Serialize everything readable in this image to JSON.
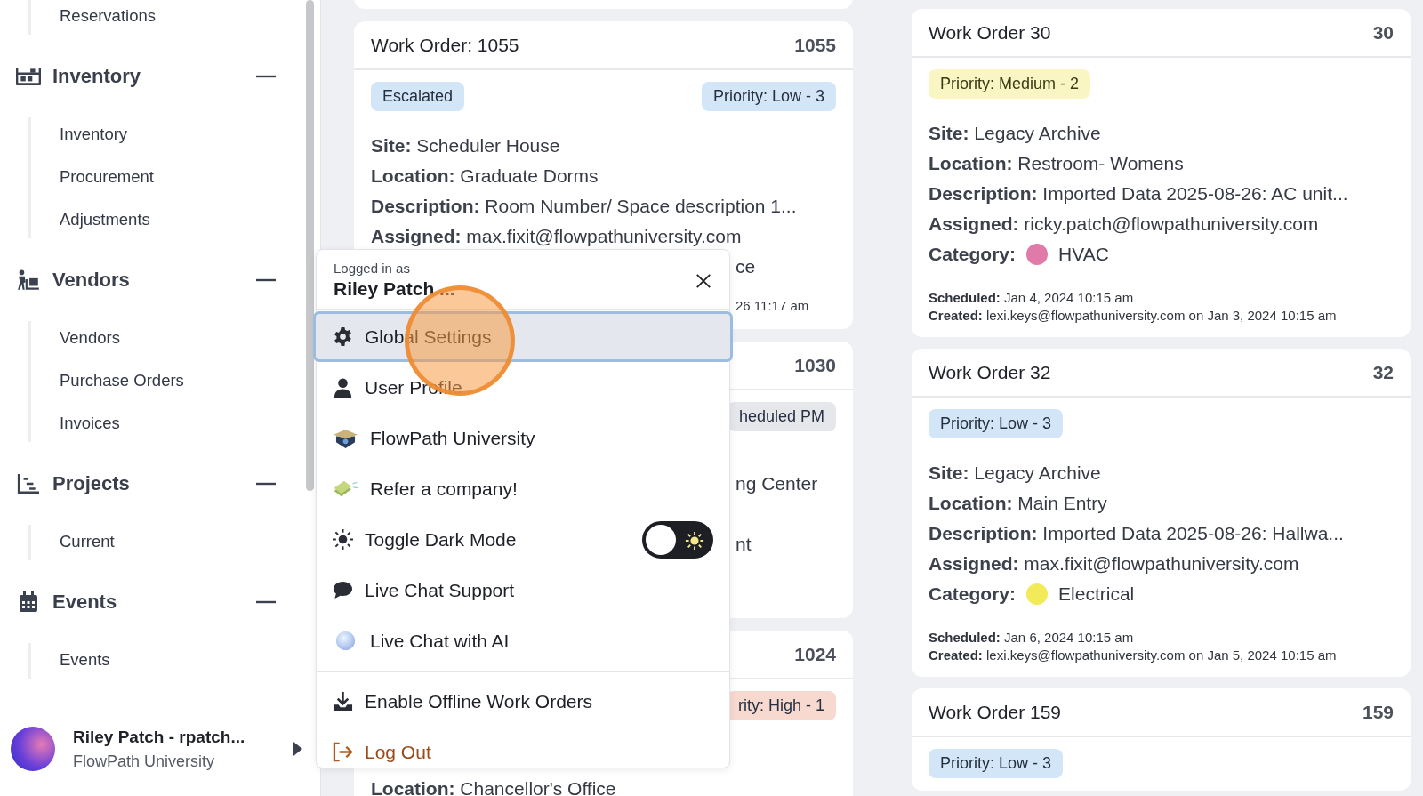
{
  "sidebar": {
    "top_item": "Reservations",
    "sections": [
      {
        "title": "Inventory",
        "kind": "inventory",
        "expanded": true,
        "items": [
          "Inventory",
          "Procurement",
          "Adjustments"
        ]
      },
      {
        "title": "Vendors",
        "kind": "vendors",
        "expanded": true,
        "items": [
          "Vendors",
          "Purchase Orders",
          "Invoices"
        ]
      },
      {
        "title": "Projects",
        "kind": "projects",
        "expanded": true,
        "items": [
          "Current"
        ]
      },
      {
        "title": "Events",
        "kind": "events",
        "expanded": true,
        "items": [
          "Events"
        ]
      }
    ],
    "user": {
      "name": "Riley Patch - rpatch...",
      "organization": "FlowPath University"
    }
  },
  "middle_work_orders": [
    {
      "title": "Work Order: 1055",
      "number": "1055",
      "tags": [
        {
          "label": "Escalated",
          "kind": "status"
        },
        {
          "label": "Priority: Low - 3",
          "kind": "low"
        }
      ],
      "fields": [
        {
          "label": "Site:",
          "value": "Scheduler House"
        },
        {
          "label": "Location:",
          "value": "Graduate Dorms"
        },
        {
          "label": "Description:",
          "value": "Room Number/ Space description 1..."
        },
        {
          "label": "Assigned:",
          "value": "max.fixit@flowpathuniversity.com"
        }
      ],
      "fragments": [
        {
          "text": "ce",
          "kind": "line"
        },
        {
          "text": "26 11:17 am",
          "kind": "meta"
        }
      ]
    },
    {
      "number": "1030",
      "tags": [
        {
          "label": "heduled PM",
          "kind": "pm"
        }
      ],
      "fragments": [
        {
          "text": "ng Center",
          "kind": "line"
        },
        {
          "text": "nt",
          "kind": "line"
        }
      ]
    },
    {
      "number": "1024",
      "tags": [
        {
          "label": "rity: High - 1",
          "kind": "high"
        }
      ],
      "fields": [
        {
          "label": "Location:",
          "value": "Chancellor's Office"
        }
      ]
    }
  ],
  "right_work_orders": [
    {
      "title": "Work Order 30",
      "number": "30",
      "tags": [
        {
          "label": "Priority: Medium - 2",
          "kind": "medium"
        }
      ],
      "fields": [
        {
          "label": "Site:",
          "value": "Legacy Archive"
        },
        {
          "label": "Location:",
          "value": "Restroom- Womens"
        },
        {
          "label": "Description:",
          "value": "Imported Data 2025-08-26: AC unit..."
        },
        {
          "label": "Assigned:",
          "value": "ricky.patch@flowpathuniversity.com"
        }
      ],
      "category": {
        "label": "Category:",
        "value": "HVAC",
        "color": "#e07aa9"
      },
      "scheduled": {
        "label": "Scheduled:",
        "value": "Jan 4, 2024 10:15 am"
      },
      "created": {
        "label": "Created:",
        "value": "lexi.keys@flowpathuniversity.com on Jan 3, 2024 10:15 am"
      }
    },
    {
      "title": "Work Order 32",
      "number": "32",
      "tags": [
        {
          "label": "Priority: Low - 3",
          "kind": "low"
        }
      ],
      "fields": [
        {
          "label": "Site:",
          "value": "Legacy Archive"
        },
        {
          "label": "Location:",
          "value": "Main Entry"
        },
        {
          "label": "Description:",
          "value": "Imported Data 2025-08-26: Hallwa..."
        },
        {
          "label": "Assigned:",
          "value": "max.fixit@flowpathuniversity.com"
        }
      ],
      "category": {
        "label": "Category:",
        "value": "Electrical",
        "color": "#f3ea5a"
      },
      "scheduled": {
        "label": "Scheduled:",
        "value": "Jan 6, 2024 10:15 am"
      },
      "created": {
        "label": "Created:",
        "value": "lexi.keys@flowpathuniversity.com on Jan 5, 2024 10:15 am"
      }
    },
    {
      "title": "Work Order 159",
      "number": "159",
      "tags": [
        {
          "label": "Priority: Low - 3",
          "kind": "low"
        }
      ]
    }
  ],
  "user_menu": {
    "caption": "Logged in as",
    "name": "Riley Patch ...",
    "items": [
      {
        "label": "Global Settings",
        "kind": "settings",
        "selected": true
      },
      {
        "label": "User Profile",
        "kind": "user",
        "selected": false
      },
      {
        "label": "FlowPath University",
        "kind": "school",
        "selected": false
      },
      {
        "label": "Refer a company!",
        "kind": "money",
        "selected": false
      },
      {
        "label": "Toggle Dark Mode",
        "kind": "theme",
        "selected": false,
        "on": false
      },
      {
        "label": "Live Chat Support",
        "kind": "chat",
        "selected": false
      },
      {
        "label": "Live Chat with AI",
        "kind": "ai",
        "selected": false
      }
    ],
    "footer_items": [
      {
        "label": "Enable Offline Work Orders",
        "kind": "download"
      },
      {
        "label": "Log Out",
        "kind": "logout"
      }
    ]
  }
}
